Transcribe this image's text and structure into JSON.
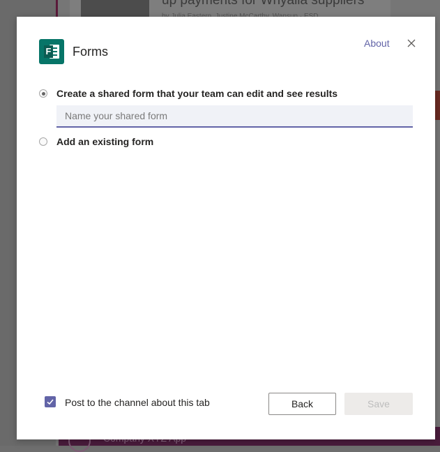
{
  "background": {
    "headline": "up payments for Whyalla suppliers",
    "byline": "by Julia Eastern, Justine McCarthy, Wansun · ESD",
    "bottom_text": "Company XYZ App"
  },
  "dialog": {
    "app_name": "Forms",
    "logo_letter": "F",
    "about_label": "About",
    "close_icon": "close-icon",
    "options": [
      {
        "label": "Create a shared form that your team can edit and see results",
        "selected": true
      },
      {
        "label": "Add an existing form",
        "selected": false
      }
    ],
    "name_input": {
      "value": "",
      "placeholder": "Name your shared form"
    },
    "post_checkbox": {
      "label": "Post to the channel about this tab",
      "checked": true
    },
    "buttons": {
      "back": "Back",
      "save": "Save",
      "save_enabled": false
    }
  },
  "colors": {
    "accent": "#6264a7",
    "forms_brand": "#077568"
  }
}
